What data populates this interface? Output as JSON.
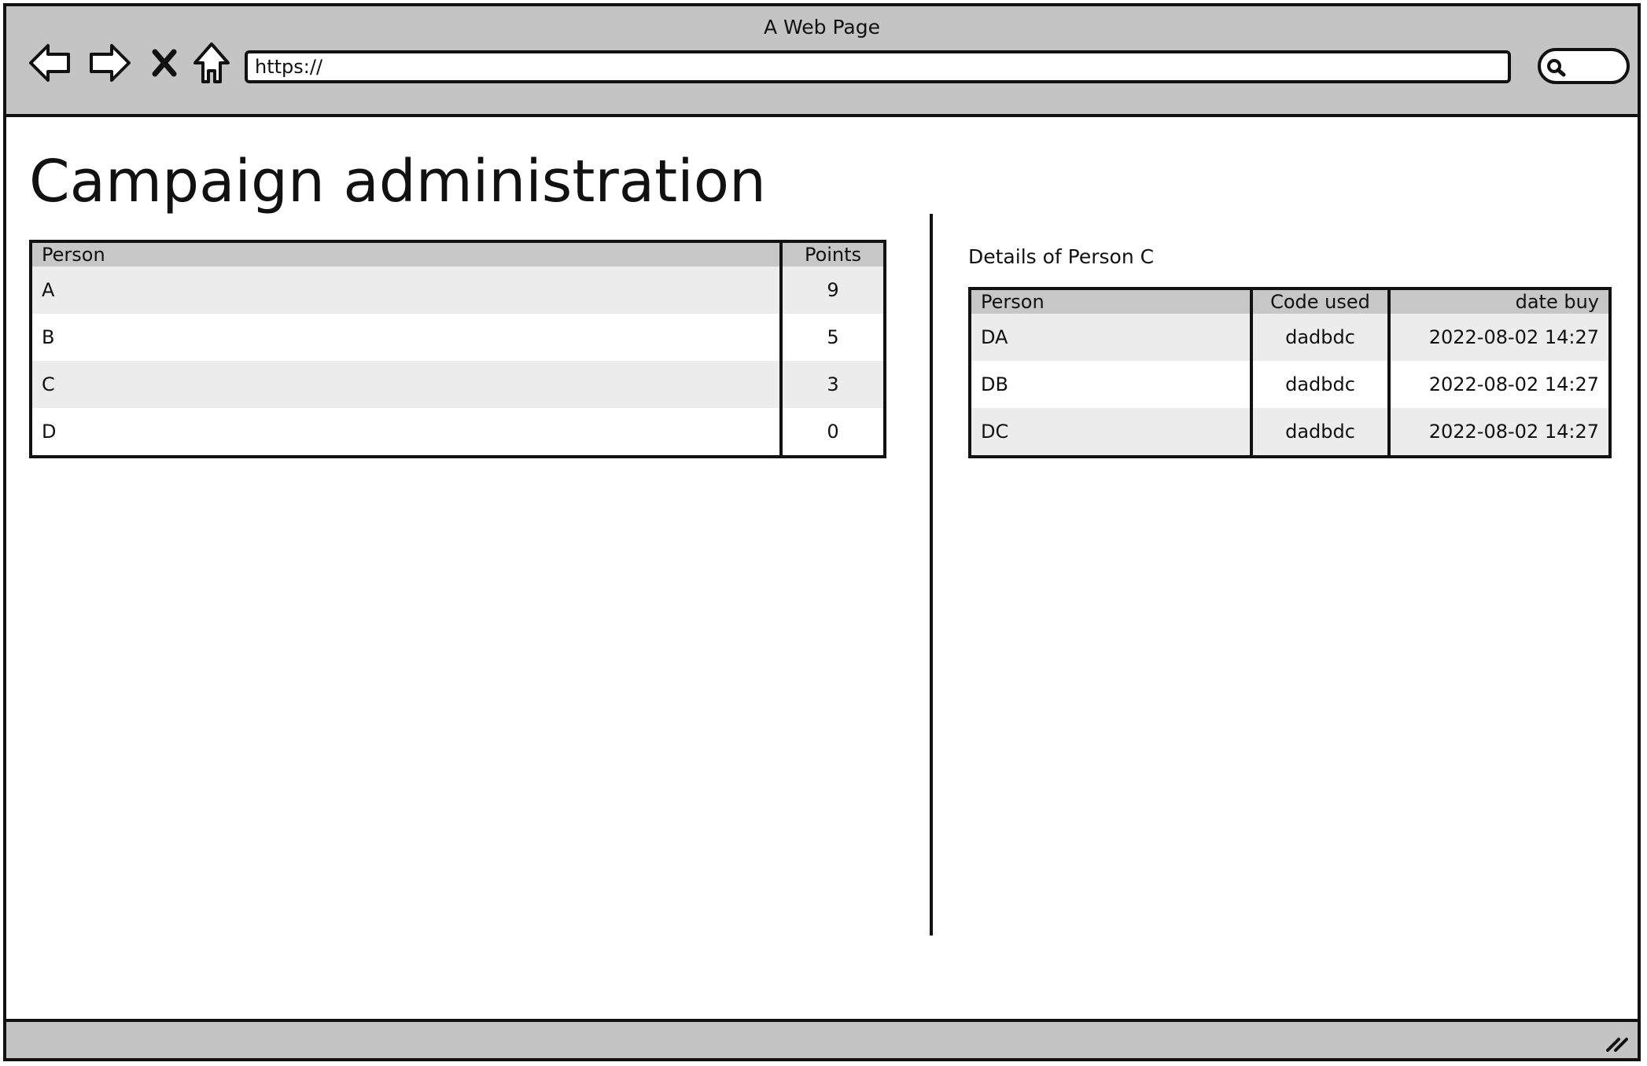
{
  "window": {
    "title": "A Web Page"
  },
  "toolbar": {
    "back_icon": "back-arrow-icon",
    "forward_icon": "forward-arrow-icon",
    "stop_icon": "close-icon",
    "home_icon": "home-icon",
    "address_value": "https://",
    "search_icon": "search-icon"
  },
  "page": {
    "title": "Campaign administration"
  },
  "points_table": {
    "headers": {
      "person": "Person",
      "points": "Points"
    },
    "rows": [
      {
        "person": "A",
        "points": "9"
      },
      {
        "person": "B",
        "points": "5"
      },
      {
        "person": "C",
        "points": "3"
      },
      {
        "person": "D",
        "points": "0"
      }
    ]
  },
  "details": {
    "heading": "Details of Person C",
    "headers": {
      "person": "Person",
      "code": "Code used",
      "date": "date buy"
    },
    "rows": [
      {
        "person": "DA",
        "code": "dadbdc",
        "date": "2022-08-02 14:27"
      },
      {
        "person": "DB",
        "code": "dadbdc",
        "date": "2022-08-02 14:27"
      },
      {
        "person": "DC",
        "code": "dadbdc",
        "date": "2022-08-02 14:27"
      }
    ]
  },
  "colors": {
    "chrome": "#c4c4c4",
    "header_row": "#c7c7c7",
    "alt_row": "#ececec",
    "ink": "#111111"
  }
}
